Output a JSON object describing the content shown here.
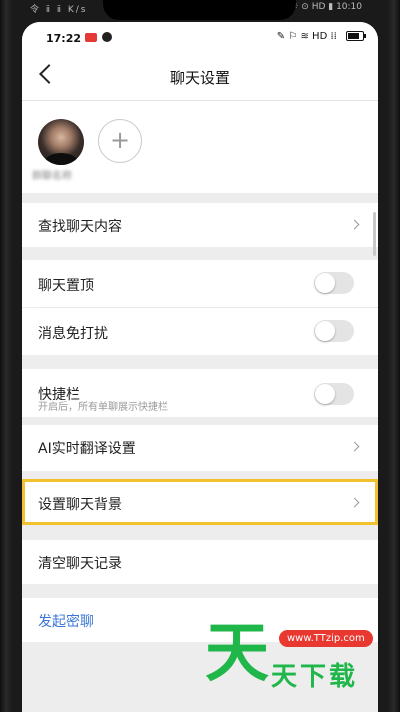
{
  "outer_status": {
    "left": "令 ⅱ ⅱ K/s",
    "right": "☼ ⊙ HD ▮ 10:10"
  },
  "status_bar": {
    "time": "17:22",
    "right_icons": "✎ ⚐ ≋ HD ⁞⁞"
  },
  "header": {
    "title": "聊天设置",
    "back_icon": "chevron-left-icon"
  },
  "members": {
    "avatar_name": "群聊名称",
    "add_icon": "+"
  },
  "settings": {
    "search_history": "查找聊天内容",
    "pin_chat": "聊天置顶",
    "mute_notifications": "消息免打扰",
    "shortcut_bar": "快捷栏",
    "shortcut_hint": "开启后，所有单聊展示快捷栏",
    "ai_translate": "AI实时翻译设置",
    "chat_background": "设置聊天背景",
    "clear_history": "清空聊天记录",
    "start_secret_chat": "发起密聊"
  },
  "toggles": {
    "pin_chat": false,
    "mute_notifications": false,
    "shortcut_bar": false
  },
  "watermark": {
    "big_char": "天",
    "url": "www.TTzip.com",
    "text": "天下载"
  },
  "colors": {
    "highlight": "#f2c12e",
    "link": "#3a76d8",
    "watermark_green": "#20b74a"
  }
}
